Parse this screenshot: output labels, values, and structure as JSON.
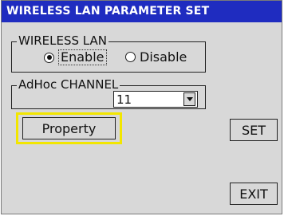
{
  "window": {
    "title": "WIRELESS LAN PARAMETER SET"
  },
  "wireless_lan": {
    "label": "WIRELESS LAN",
    "options": [
      {
        "label": "Enable",
        "selected": true
      },
      {
        "label": "Disable",
        "selected": false
      }
    ]
  },
  "adhoc": {
    "label": "AdHoc CHANNEL",
    "value": "11"
  },
  "buttons": {
    "property": "Property",
    "set": "SET",
    "exit": "EXIT"
  },
  "colors": {
    "titlebar": "#1f2cc0",
    "highlight": "#f2e600",
    "window_bg": "#d8d8d8"
  }
}
